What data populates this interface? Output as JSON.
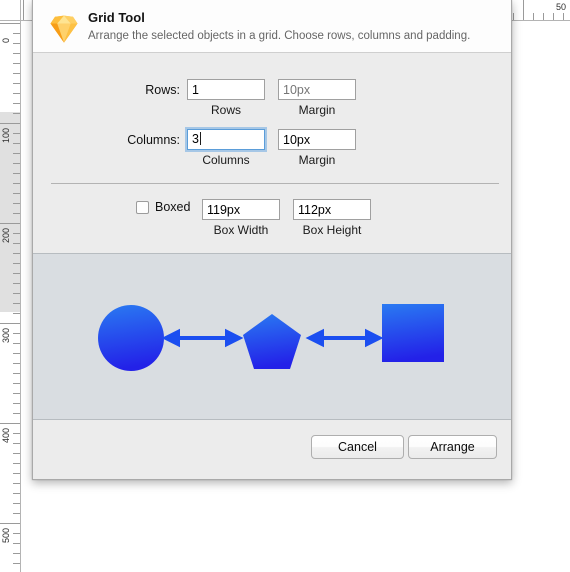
{
  "window": {
    "rulers": {
      "vertical_labels": [
        "0",
        "100",
        "200",
        "300",
        "400",
        "500"
      ],
      "horizontal_labels": [
        "50"
      ]
    }
  },
  "dialog": {
    "logo_icon": "sketch-diamond-icon",
    "title": "Grid Tool",
    "subtitle": "Arrange the selected objects in a grid. Choose rows, columns and padding.",
    "fields": {
      "rows": {
        "label": "Rows:",
        "value": "1",
        "sublabel": "Rows"
      },
      "rows_margin": {
        "placeholder": "10px",
        "value": "",
        "sublabel": "Margin"
      },
      "columns": {
        "label": "Columns:",
        "value": "3",
        "sublabel": "Columns",
        "focused": true
      },
      "columns_margin": {
        "placeholder": "10px",
        "value": "10px",
        "sublabel": "Margin"
      },
      "boxed": {
        "label": "Boxed",
        "checked": false
      },
      "box_width": {
        "value": "119px",
        "sublabel": "Box Width"
      },
      "box_height": {
        "value": "112px",
        "sublabel": "Box Height"
      }
    },
    "preview": {
      "shapes": [
        "circle-shape",
        "pentagon-shape",
        "square-shape"
      ],
      "connectors": [
        "double-arrow-left",
        "double-arrow-right"
      ],
      "shape_color_top": "#2a7af2",
      "shape_color_bottom": "#2321e8",
      "canvas_color": "#d9dde1"
    },
    "buttons": {
      "cancel": "Cancel",
      "arrange": "Arrange"
    }
  }
}
